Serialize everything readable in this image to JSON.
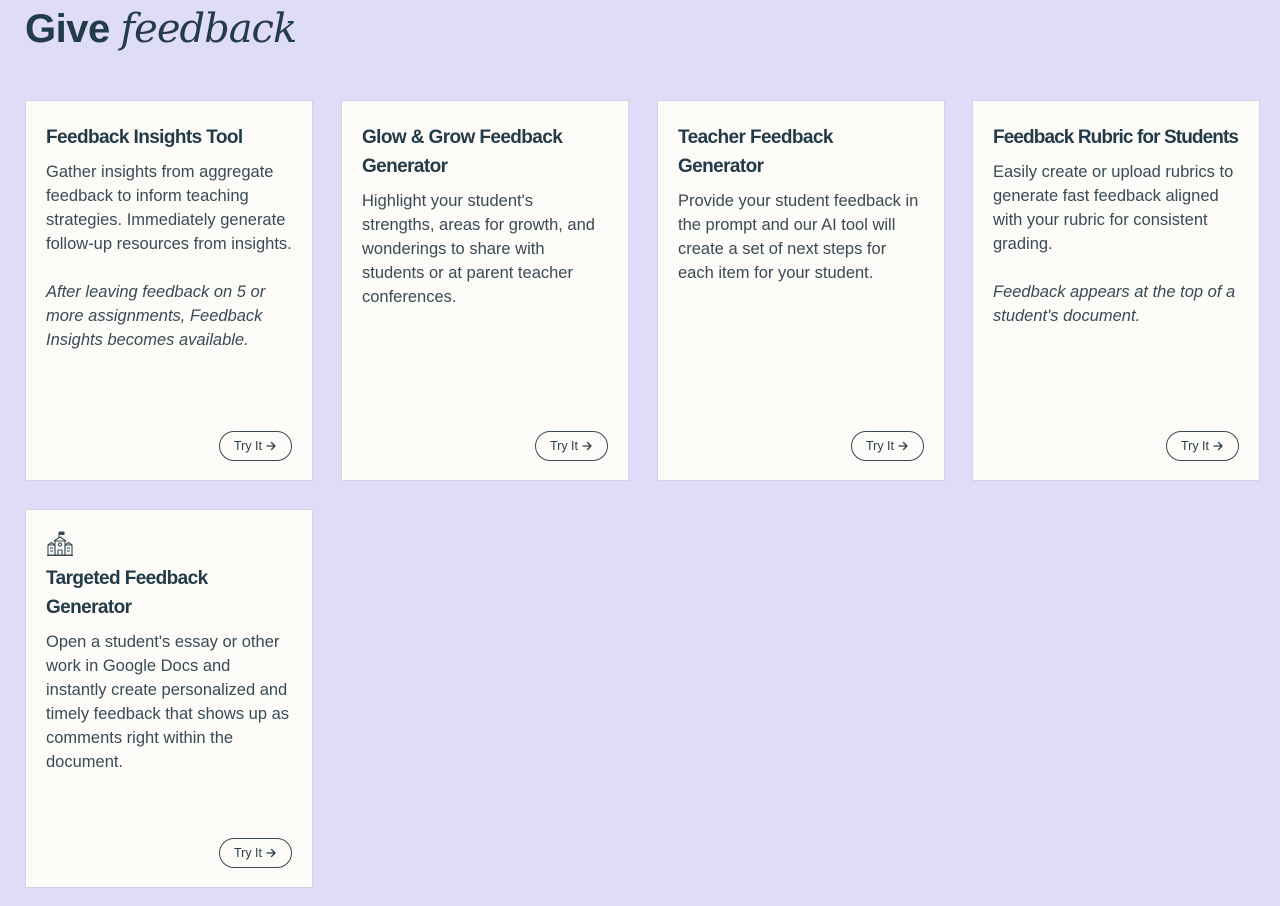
{
  "header": {
    "title_plain": "Give",
    "title_italic": "feedback"
  },
  "cards": [
    {
      "title": "Feedback Insights Tool",
      "description": "Gather insights from aggregate feedback to inform teaching strategies. Immediately generate follow-up resources from insights.",
      "note": "After leaving feedback on 5 or more assignments, Feedback Insights becomes available.",
      "button_label": "Try It"
    },
    {
      "title": "Glow & Grow Feedback Generator",
      "description": "Highlight your student's strengths, areas for growth, and wonderings to share with students or at parent teacher conferences.",
      "button_label": "Try It"
    },
    {
      "title": "Teacher Feedback Generator",
      "description": "Provide your student feedback in the prompt and our AI tool will create a set of next steps for each item for your student.",
      "button_label": "Try It"
    },
    {
      "title": "Feedback Rubric for Students",
      "description": "Easily create or upload rubrics to generate fast feedback aligned with your rubric for consistent grading.",
      "note": "Feedback appears at the top of a student's document.",
      "button_label": "Try It"
    },
    {
      "icon": "school-building-icon",
      "title": "Targeted Feedback Generator",
      "description": "Open a student's essay or other work in Google Docs and instantly create personalized and timely feedback that shows up as comments right within the document.",
      "button_label": "Try It"
    }
  ],
  "colors": {
    "background": "#dedcf6",
    "card_background": "#fcfbf8",
    "text": "#2c3e4a"
  }
}
